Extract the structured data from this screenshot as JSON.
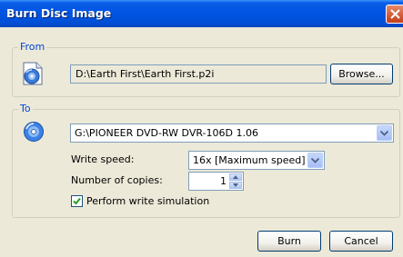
{
  "window": {
    "title": "Burn Disc Image"
  },
  "from": {
    "legend": "From",
    "path": "D:\\Earth First\\Earth First.p2i",
    "browse_label": "Browse..."
  },
  "to": {
    "legend": "To",
    "drive": "G:\\PIONEER DVD-RW  DVR-106D 1.06",
    "write_speed_label": "Write speed:",
    "write_speed_value": "16x [Maximum speed]",
    "copies_label": "Number of copies:",
    "copies_value": "1",
    "simulation_label": "Perform write simulation",
    "simulation_checked": true
  },
  "buttons": {
    "burn": "Burn",
    "cancel": "Cancel"
  },
  "colors": {
    "titlebar": "#0054e3",
    "legend_text": "#0046d5",
    "close_button": "#c43d18"
  },
  "icons": [
    "close-icon",
    "disc-image-icon",
    "cd-drive-icon",
    "dropdown-arrow-icon",
    "checkmark-icon"
  ]
}
